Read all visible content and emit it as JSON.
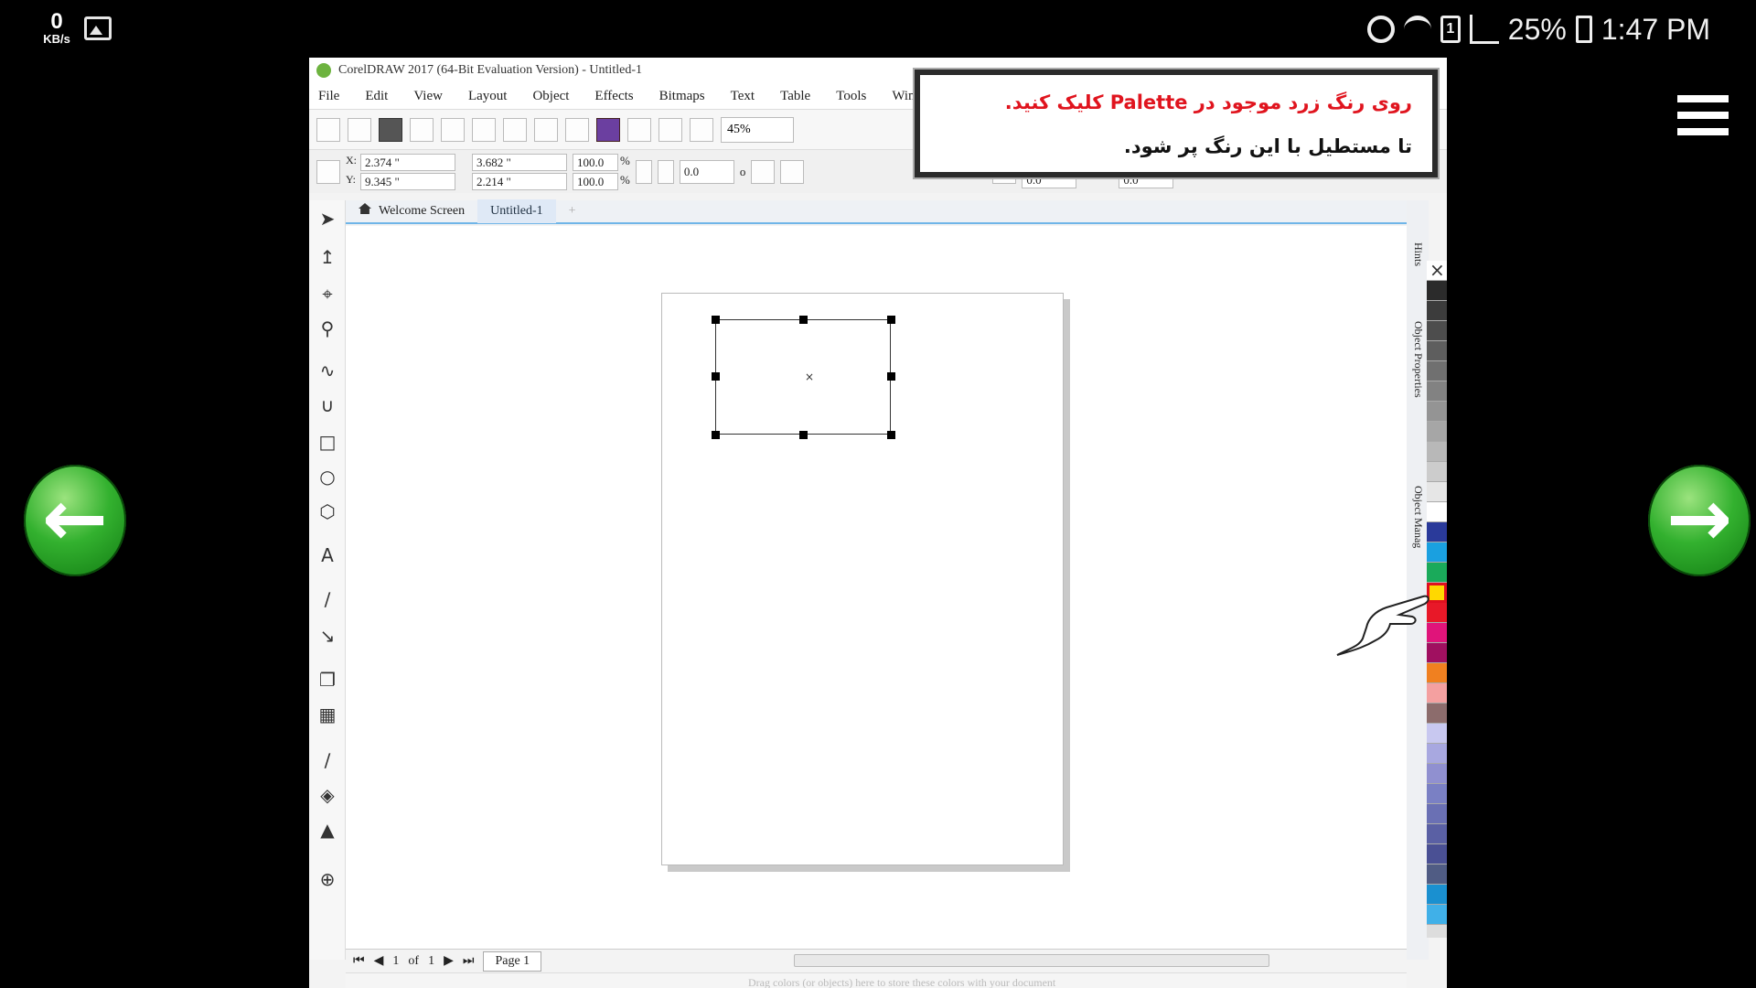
{
  "statusbar": {
    "net_speed_value": "0",
    "net_speed_unit": "KB/s",
    "sim_slot": "1",
    "battery": "25%",
    "time": "1:47 PM"
  },
  "window": {
    "title": "CorelDRAW 2017 (64-Bit Evaluation Version) - Untitled-1"
  },
  "menu": [
    "File",
    "Edit",
    "View",
    "Layout",
    "Object",
    "Effects",
    "Bitmaps",
    "Text",
    "Table",
    "Tools",
    "Window"
  ],
  "toolbar": {
    "zoom": "45%"
  },
  "property_bar": {
    "x_label": "X:",
    "x_value": "2.374 \"",
    "y_label": "Y:",
    "y_value": "9.345 \"",
    "width_value": "3.682 \"",
    "height_value": "2.214 \"",
    "scale_x": "100.0",
    "scale_y": "100.0",
    "pct": "%",
    "rotation": "0.0",
    "degree": "o",
    "corner_1": "0.0",
    "corner_2": "0.0"
  },
  "tabs": {
    "welcome": "Welcome Screen",
    "document": "Untitled-1",
    "add": "+"
  },
  "dockers": {
    "hints": "Hints",
    "object_properties": "Object Properties",
    "object_manager": "Object Manag"
  },
  "page_nav": {
    "current": "1",
    "of": "of",
    "total": "1",
    "page_tab": "Page 1"
  },
  "document_palette": {
    "hint": "Drag colors (or objects) here to store these colors with your document"
  },
  "tutorial": {
    "line1": "روی رنگ زرد موجود در  Palette  کلیک کنید.",
    "line2": "تا مستطیل با این رنگ پر شود."
  },
  "palette_colors": [
    "none",
    "#2b2b2b",
    "#3c3c3c",
    "#4d4d4d",
    "#5e5e5e",
    "#707070",
    "#828282",
    "#949494",
    "#a6a6a6",
    "#b8b8b8",
    "#cccccc",
    "#e6e6e6",
    "#ffffff",
    "#2a3a9a",
    "#1aa0e0",
    "#1aaa5a",
    "yellow",
    "#e81828",
    "#e0147a",
    "#a01060",
    "#f08020",
    "#f4a0a0",
    "#8c6c6c",
    "#c8c8f0",
    "#a8a8e0",
    "#9090d0",
    "#7a80c4",
    "#6a70b4",
    "#5a60a4",
    "#4a5094",
    "#505c84",
    "#1a90d0",
    "#40b0e8"
  ]
}
